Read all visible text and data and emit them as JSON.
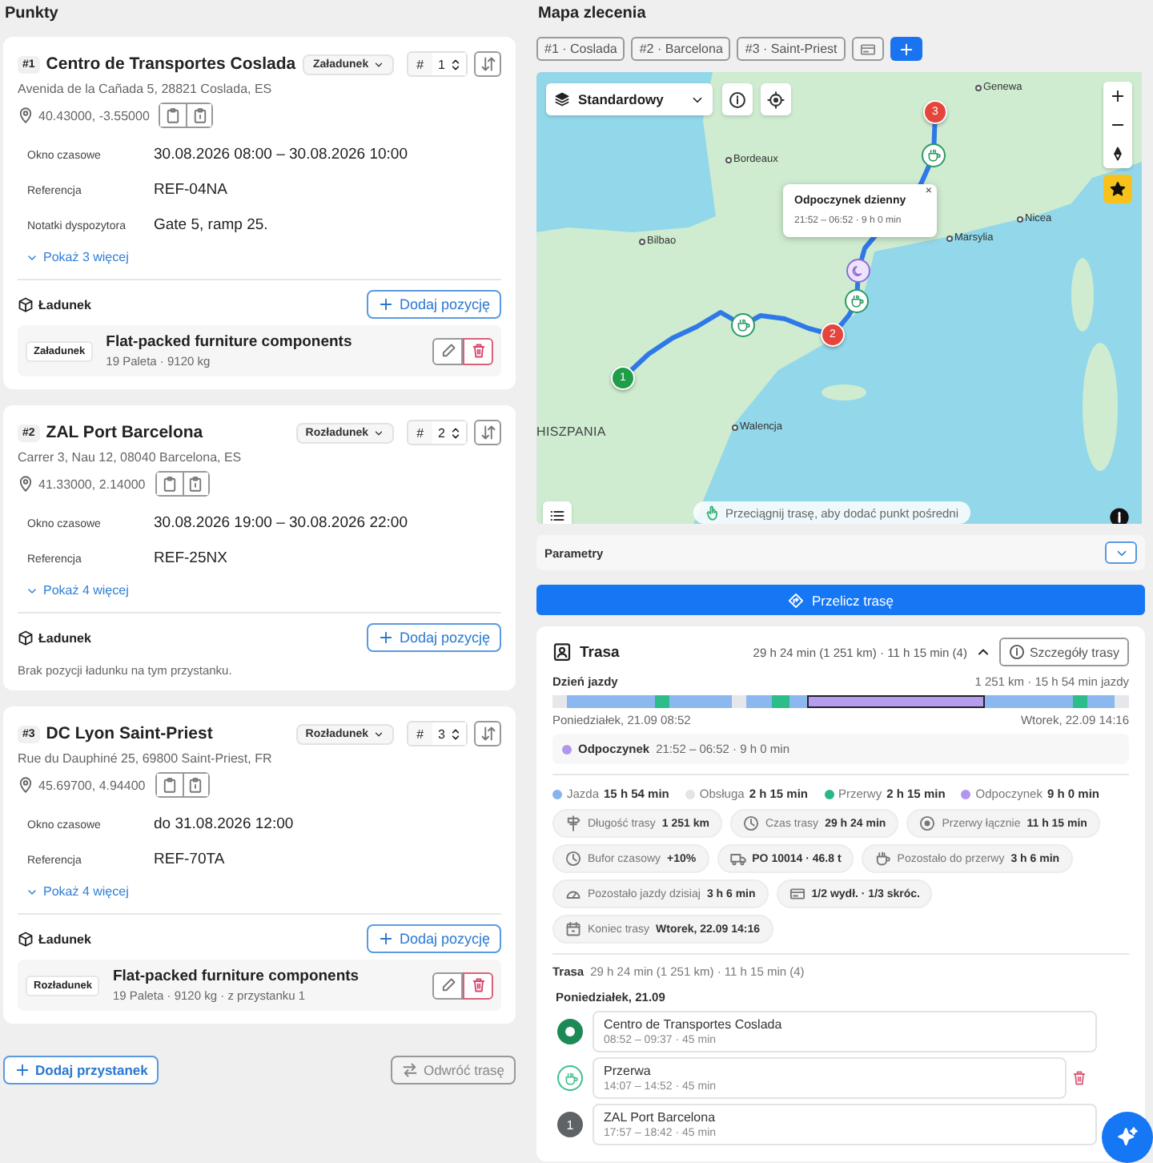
{
  "points": {
    "title": "Punkty",
    "stops": [
      {
        "badge": "#1",
        "name": "Centro de Transportes Coslada",
        "type": "Załadunek",
        "order_symbol": "#",
        "order": "1",
        "address": "Avenida de la Cañada 5, 28821 Coslada, ES",
        "coords": "40.43000, -3.55000",
        "fields": [
          {
            "label": "Okno czasowe",
            "value": "30.08.2026 08:00 – 30.08.2026 10:00"
          },
          {
            "label": "Referencja",
            "value": "REF-04NA"
          },
          {
            "label": "Notatki dyspozytora",
            "value": "Gate 5, ramp 25."
          }
        ],
        "show_more": "Pokaż 3 więcej",
        "cargo_title": "Ładunek",
        "add_item": "Dodaj pozycję",
        "items": [
          {
            "tag": "Załadunek",
            "name": "Flat-packed furniture components",
            "details": "19 Paleta · 9120 kg"
          }
        ]
      },
      {
        "badge": "#2",
        "name": "ZAL Port Barcelona",
        "type": "Rozładunek",
        "order_symbol": "#",
        "order": "2",
        "address": "Carrer 3, Nau 12, 08040 Barcelona, ES",
        "coords": "41.33000, 2.14000",
        "fields": [
          {
            "label": "Okno czasowe",
            "value": "30.08.2026 19:00 – 30.08.2026 22:00"
          },
          {
            "label": "Referencja",
            "value": "REF-25NX"
          }
        ],
        "show_more": "Pokaż 4 więcej",
        "cargo_title": "Ładunek",
        "add_item": "Dodaj pozycję",
        "empty_text": "Brak pozycji ładunku na tym przystanku."
      },
      {
        "badge": "#3",
        "name": "DC Lyon Saint-Priest",
        "type": "Rozładunek",
        "order_symbol": "#",
        "order": "3",
        "address": "Rue du Dauphiné 25, 69800 Saint-Priest, FR",
        "coords": "45.69700, 4.94400",
        "fields": [
          {
            "label": "Okno czasowe",
            "value": "do 31.08.2026 12:00"
          },
          {
            "label": "Referencja",
            "value": "REF-70TA"
          }
        ],
        "show_more": "Pokaż 4 więcej",
        "cargo_title": "Ładunek",
        "add_item": "Dodaj pozycję",
        "items": [
          {
            "tag": "Rozładunek",
            "name": "Flat-packed furniture components",
            "details": "19 Paleta · 9120 kg · z przystanku 1"
          }
        ]
      }
    ],
    "add_stop": "Dodaj przystanek",
    "reverse": "Odwróć trasę"
  },
  "map": {
    "title": "Mapa zlecenia",
    "chips": [
      "#1 · Coslada",
      "#2 · Barcelona",
      "#3 · Saint-Priest"
    ],
    "layer": "Standardowy",
    "labels": [
      {
        "kind": "city",
        "text": "Genewa"
      },
      {
        "kind": "city",
        "text": "Bordeaux"
      },
      {
        "kind": "city",
        "text": "Nicea"
      },
      {
        "kind": "city",
        "text": "Bilbao"
      },
      {
        "kind": "city",
        "text": "Marsylia"
      },
      {
        "kind": "country",
        "text": "HISZPANIA"
      },
      {
        "kind": "city",
        "text": "Walencja"
      }
    ],
    "markers": [
      {
        "kind": "stop",
        "label": "1",
        "color": "#1f9d48"
      },
      {
        "kind": "stop",
        "label": "2",
        "color": "#e4463c"
      },
      {
        "kind": "stop",
        "label": "3",
        "color": "#e4463c"
      },
      {
        "kind": "break"
      },
      {
        "kind": "break"
      },
      {
        "kind": "break"
      },
      {
        "kind": "rest"
      }
    ],
    "popup": {
      "title": "Odpoczynek dzienny",
      "text": "21:52 – 06:52 · 9 h 0 min",
      "close": "×"
    },
    "hint": "Przeciągnij trasę, aby dodać punkt pośredni"
  },
  "parameters": {
    "label": "Parametry"
  },
  "recalculate": "Przelicz trasę",
  "route": {
    "title": "Trasa",
    "summary": "29 h 24 min (1 251 km) · 11 h 15 min (4)",
    "details_button": "Szczegóły trasy",
    "day": {
      "title": "Dzień jazdy",
      "summary": "1 251 km · 15 h 54 min jazdy",
      "start": "Poniedziałek, 21.09 08:52",
      "end": "Wtorek, 22.09 14:16",
      "segments": [
        {
          "kind": "service",
          "selected": false
        },
        {
          "kind": "drive",
          "selected": false
        },
        {
          "kind": "break",
          "selected": false
        },
        {
          "kind": "drive",
          "selected": false
        },
        {
          "kind": "service",
          "selected": false
        },
        {
          "kind": "drive",
          "selected": false
        },
        {
          "kind": "break",
          "selected": false
        },
        {
          "kind": "drive",
          "selected": false
        },
        {
          "kind": "rest",
          "selected": true
        },
        {
          "kind": "drive",
          "selected": false
        },
        {
          "kind": "break",
          "selected": false
        },
        {
          "kind": "drive",
          "selected": false
        },
        {
          "kind": "service",
          "selected": false
        }
      ],
      "selection": {
        "label": "Odpoczynek",
        "text": "21:52 – 06:52 · 9 h 0 min",
        "color": "#b195ee"
      }
    },
    "legend": [
      {
        "label": "Jazda",
        "value": "15 h 54 min",
        "color": "#86b4ee"
      },
      {
        "label": "Obsługa",
        "value": "2 h 15 min",
        "color": "#e3e4e7"
      },
      {
        "label": "Przerwy",
        "value": "2 h 15 min",
        "color": "#27b883"
      },
      {
        "label": "Odpoczynek",
        "value": "9 h 0 min",
        "color": "#b195ee"
      }
    ],
    "stats": [
      {
        "kind": "signpost",
        "label": "Długość trasy",
        "value": "1 251 km"
      },
      {
        "kind": "clock",
        "label": "Czas trasy",
        "value": "29 h 24 min"
      },
      {
        "kind": "pause",
        "label": "Przerwy łącznie",
        "value": "11 h 15 min"
      },
      {
        "kind": "clock",
        "label": "Bufor czasowy",
        "value": "+10%"
      },
      {
        "kind": "truck",
        "value": "PO 10014 · 46.8 t"
      },
      {
        "kind": "cup",
        "label": "Pozostało do przerwy",
        "value": "3 h 6 min"
      },
      {
        "kind": "gauge",
        "label": "Pozostało jazdy dzisiaj",
        "value": "3 h 6 min"
      },
      {
        "kind": "card",
        "value": "1/2 wydł. · 1/3 skróc."
      },
      {
        "kind": "calendar",
        "label": "Koniec trasy",
        "value": "Wtorek, 22.09 14:16"
      }
    ],
    "plan_title": "Trasa",
    "plan_summary": "29 h 24 min (1 251 km) · 11 h 15 min (4)",
    "plan_day": "Poniedziałek, 21.09",
    "entries": [
      {
        "kind": "start",
        "name": "Centro de Transportes Coslada",
        "time": "08:52 – 09:37 · 45 min",
        "deletable": false
      },
      {
        "kind": "break",
        "name": "Przerwa",
        "time": "14:07 – 14:52 · 45 min",
        "deletable": true
      },
      {
        "kind": "stop",
        "number": "1",
        "name": "ZAL Port Barcelona",
        "time": "17:57 – 18:42 · 45 min",
        "deletable": false
      }
    ]
  }
}
